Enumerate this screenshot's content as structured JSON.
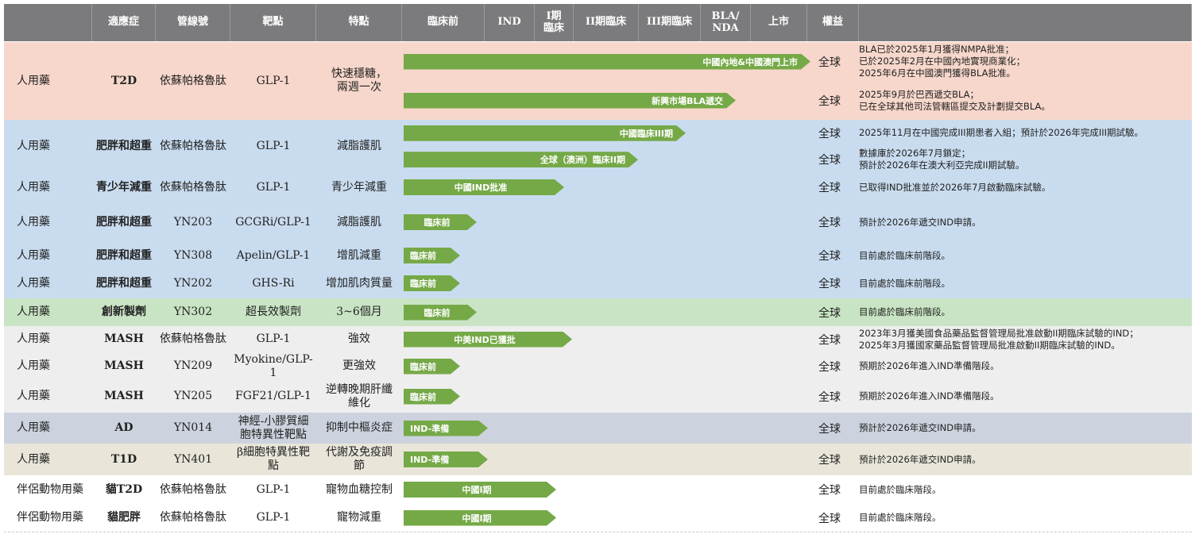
{
  "headers": [
    "",
    "適應症",
    "管線號",
    "靶點",
    "特點",
    "臨床前",
    "IND",
    "I期\n臨床",
    "II期臨床",
    "III期臨床",
    "BLA/\nNDA",
    "上市",
    "權益"
  ],
  "rows": [
    {
      "category": "人用藥",
      "indication": "T2D",
      "code": "依蘇帕格魯肽",
      "target": "GLP-1",
      "feature": "快速穩糖，\n兩週一次",
      "bg": "#f7d7cb",
      "bars": [
        {
          "label": "中國內地&中國澳門上市",
          "stage": "marketed"
        },
        {
          "label": "新興市場BLA遞交",
          "stage": "bla"
        }
      ],
      "rights": [
        "全球",
        "全球"
      ],
      "notes": [
        [
          "BLA已於2025年1月獲得NMPA批准；",
          "已於2025年2月在中國內地實現商業化；",
          "2025年6月在中國澳門獲得BLA批准。"
        ],
        [
          "2025年9月於巴西遞交BLA；",
          "已在全球其他司法管轄區提交及計劃提交BLA。"
        ]
      ]
    },
    {
      "category": "人用藥",
      "indication": "肥胖和超重",
      "code": "依蘇帕格魯肽",
      "target": "GLP-1",
      "feature": "減脂護肌",
      "bg": "#c9dcef",
      "bars": [
        {
          "label": "中國臨床III期",
          "stage": "phase3"
        },
        {
          "label": "全球（澳洲）臨床II期",
          "stage": "phase2"
        }
      ],
      "rights": [
        "全球",
        "全球"
      ],
      "notes": [
        [
          "2025年11月在中國完成III期患者入組；預計於2026年完成III期試驗。"
        ],
        [
          "數據庫於2026年7月鎖定；",
          "預計於2026年在澳大利亞完成II期試驗。"
        ]
      ]
    },
    {
      "category": "人用藥",
      "indication": "青少年減重",
      "code": "依蘇帕格魯肽",
      "target": "GLP-1",
      "feature": "青少年減重",
      "bg": "#c9dcef",
      "bars": [
        {
          "label": "中國IND批准",
          "stage": "ind"
        }
      ],
      "rights": [
        "全球"
      ],
      "notes": [
        [
          "已取得IND批准並於2026年7月啟動臨床試驗。"
        ]
      ]
    },
    {
      "category": "人用藥",
      "indication": "肥胖和超重",
      "code": "YN203",
      "target": "GCGRi/GLP-1",
      "feature": "減脂護肌",
      "bg": "#c9dcef",
      "bars": [
        {
          "label": "臨床前",
          "stage": "preclinical"
        }
      ],
      "rights": [
        "全球"
      ],
      "notes": [
        [
          "預計於2026年遞交IND申請。"
        ]
      ]
    },
    {
      "category": "人用藥",
      "indication": "肥胖和超重",
      "code": "YN308",
      "target": "Apelin/GLP-1",
      "feature": "增肌減重",
      "bg": "#c9dcef",
      "bars": [
        {
          "label": "臨床前",
          "stage": "preclinical_short"
        }
      ],
      "rights": [
        "全球"
      ],
      "notes": [
        [
          "目前處於臨床前階段。"
        ]
      ]
    },
    {
      "category": "人用藥",
      "indication": "肥胖和超重",
      "code": "YN202",
      "target": "GHS-Ri",
      "feature": "增加肌肉質量",
      "bg": "#c9dcef",
      "bars": [
        {
          "label": "臨床前",
          "stage": "preclinical_short"
        }
      ],
      "rights": [
        "全球"
      ],
      "notes": [
        [
          "目前處於臨床前階段。"
        ]
      ]
    },
    {
      "category": "人用藥",
      "indication": "創新製劑",
      "code": "YN302",
      "target": "超長效製劑",
      "feature": "3~6個月",
      "bg": "#c9e4c4",
      "bars": [
        {
          "label": "臨床前",
          "stage": "preclinical"
        }
      ],
      "rights": [
        "全球"
      ],
      "notes": [
        [
          "目前處於臨床前階段。"
        ]
      ]
    },
    {
      "category": "人用藥",
      "indication": "MASH",
      "code": "依蘇帕格魯肽",
      "target": "GLP-1",
      "feature": "強效",
      "bg": "#eeeeee",
      "bars": [
        {
          "label": "中美IND已獲批",
          "stage": "ind_plus"
        }
      ],
      "rights": [
        "全球"
      ],
      "notes": [
        [
          "2023年3月獲美國食品藥品監督管理局批准啟動II期臨床試驗的IND；",
          "2025年3月獲國家藥品監督管理局批准啟動II期臨床試驗的IND。"
        ]
      ]
    },
    {
      "category": "人用藥",
      "indication": "MASH",
      "code": "YN209",
      "target": "Myokine/GLP-1",
      "feature": "更強效",
      "bg": "#eeeeee",
      "bars": [
        {
          "label": "臨床前",
          "stage": "preclinical_short"
        }
      ],
      "rights": [
        "全球"
      ],
      "notes": [
        [
          "預期於2026年進入IND準備階段。"
        ]
      ]
    },
    {
      "category": "人用藥",
      "indication": "MASH",
      "code": "YN205",
      "target": "FGF21/GLP-1",
      "feature": "逆轉晚期肝纖\n維化",
      "bg": "#eeeeee",
      "bars": [
        {
          "label": "臨床前",
          "stage": "preclinical_short"
        }
      ],
      "rights": [
        "全球"
      ],
      "notes": [
        [
          "預期於2026年進入IND準備階段。"
        ]
      ]
    },
    {
      "category": "人用藥",
      "indication": "AD",
      "code": "YN014",
      "target": "神經-小膠質細\n胞特異性靶點",
      "feature": "抑制中樞炎症",
      "bg": "#ccd3de",
      "bars": [
        {
          "label": "IND-準備",
          "stage": "ind_prep"
        }
      ],
      "rights": [
        "全球"
      ],
      "notes": [
        [
          "預計於2026年遞交IND申請。"
        ]
      ]
    },
    {
      "category": "人用藥",
      "indication": "T1D",
      "code": "YN401",
      "target": "β細胞特異性靶\n點",
      "feature": "代謝及免疫調\n節",
      "bg": "#e9e6d9",
      "bars": [
        {
          "label": "IND-準備",
          "stage": "ind_prep"
        }
      ],
      "rights": [
        "全球"
      ],
      "notes": [
        [
          "預計於2026年遞交IND申請。"
        ]
      ]
    },
    {
      "category": "伴侶動物用藥",
      "indication": "貓T2D",
      "code": "依蘇帕格魯肽",
      "target": "GLP-1",
      "feature": "寵物血糖控制",
      "bg": "#ffffff",
      "bars": [
        {
          "label": "中國I期",
          "stage": "phase1"
        }
      ],
      "rights": [
        "全球"
      ],
      "notes": [
        [
          "目前處於臨床階段。"
        ]
      ]
    },
    {
      "category": "伴侶動物用藥",
      "indication": "貓肥胖",
      "code": "依蘇帕格魯肽",
      "target": "GLP-1",
      "feature": "寵物減重",
      "bg": "#ffffff",
      "bars": [
        {
          "label": "中國I期",
          "stage": "phase1"
        }
      ],
      "rights": [
        "全球"
      ],
      "notes": [
        [
          "目前處於臨床階段。"
        ]
      ]
    }
  ],
  "colors": {
    "header_bg": "#7b7b7d",
    "bar": "#75a947",
    "bar_text": "#ffffff"
  }
}
